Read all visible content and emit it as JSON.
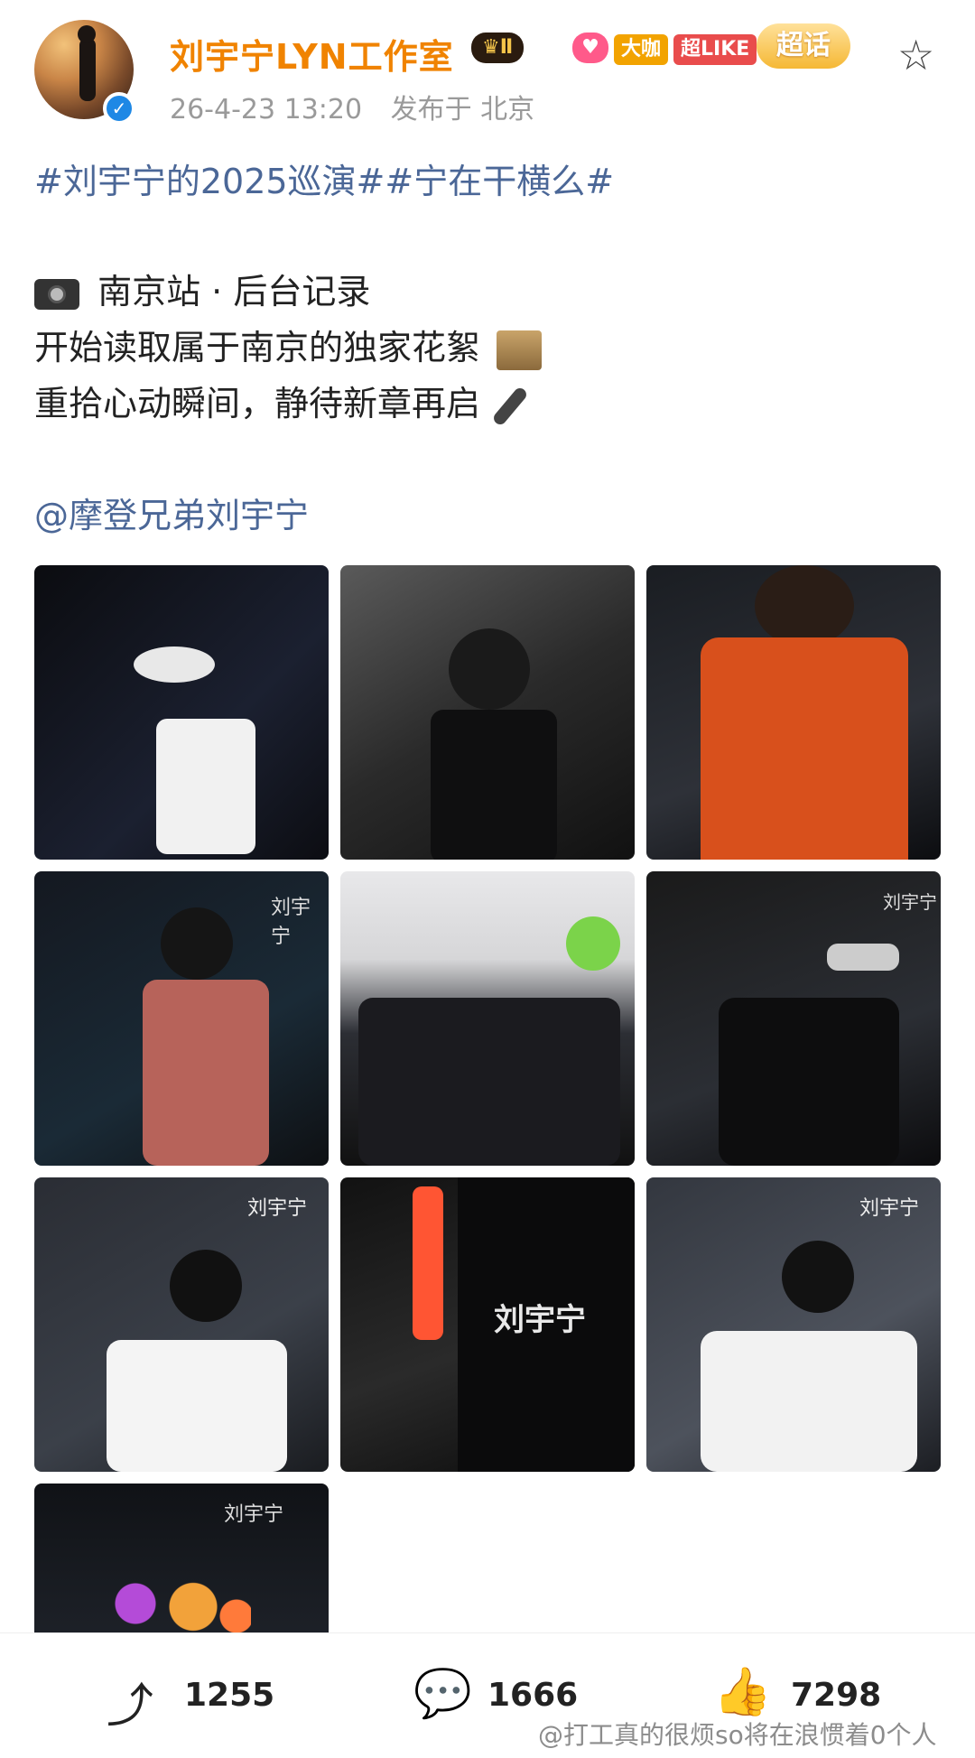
{
  "header": {
    "username": "刘宇宁LYN工作室",
    "badges": {
      "crown": "♛Ⅱ",
      "fan": "♥",
      "dakai": "大咖",
      "chaolike": "超LIKE",
      "chaohua": "超话"
    },
    "date": "26-4-23 13:20",
    "location": "发布于 北京"
  },
  "post": {
    "tags": "#刘宇宁的2025巡演##宁在干横么#",
    "line1": "南京站 · 后台记录",
    "line2": "开始读取属于南京的独家花絮",
    "line3": "重拾心动瞬间，静待新章再启",
    "mention": "@摩登兄弟刘宇宁"
  },
  "photos": [
    {
      "label": ""
    },
    {
      "label": ""
    },
    {
      "label": ""
    },
    {
      "label": "刘宇宁"
    },
    {
      "label": ""
    },
    {
      "label": "刘宇宁"
    },
    {
      "label": "刘宇宁"
    },
    {
      "label": "刘宇宁"
    },
    {
      "label": "刘宇宁"
    },
    {
      "label": "刘宇宁"
    }
  ],
  "actions": {
    "share_count": "1255",
    "comment_count": "1666",
    "like_count": "7298"
  },
  "watermark": "@打工真的很烦so将在浪惯着0个人",
  "icons": {
    "share": "share-icon",
    "comment": "comment-icon",
    "like": "thumbs-up-icon",
    "favorite": "star-icon",
    "verified": "verified-icon"
  },
  "colors": {
    "username": "#f08300",
    "link": "#4b6797",
    "verified": "#1e88e5"
  }
}
